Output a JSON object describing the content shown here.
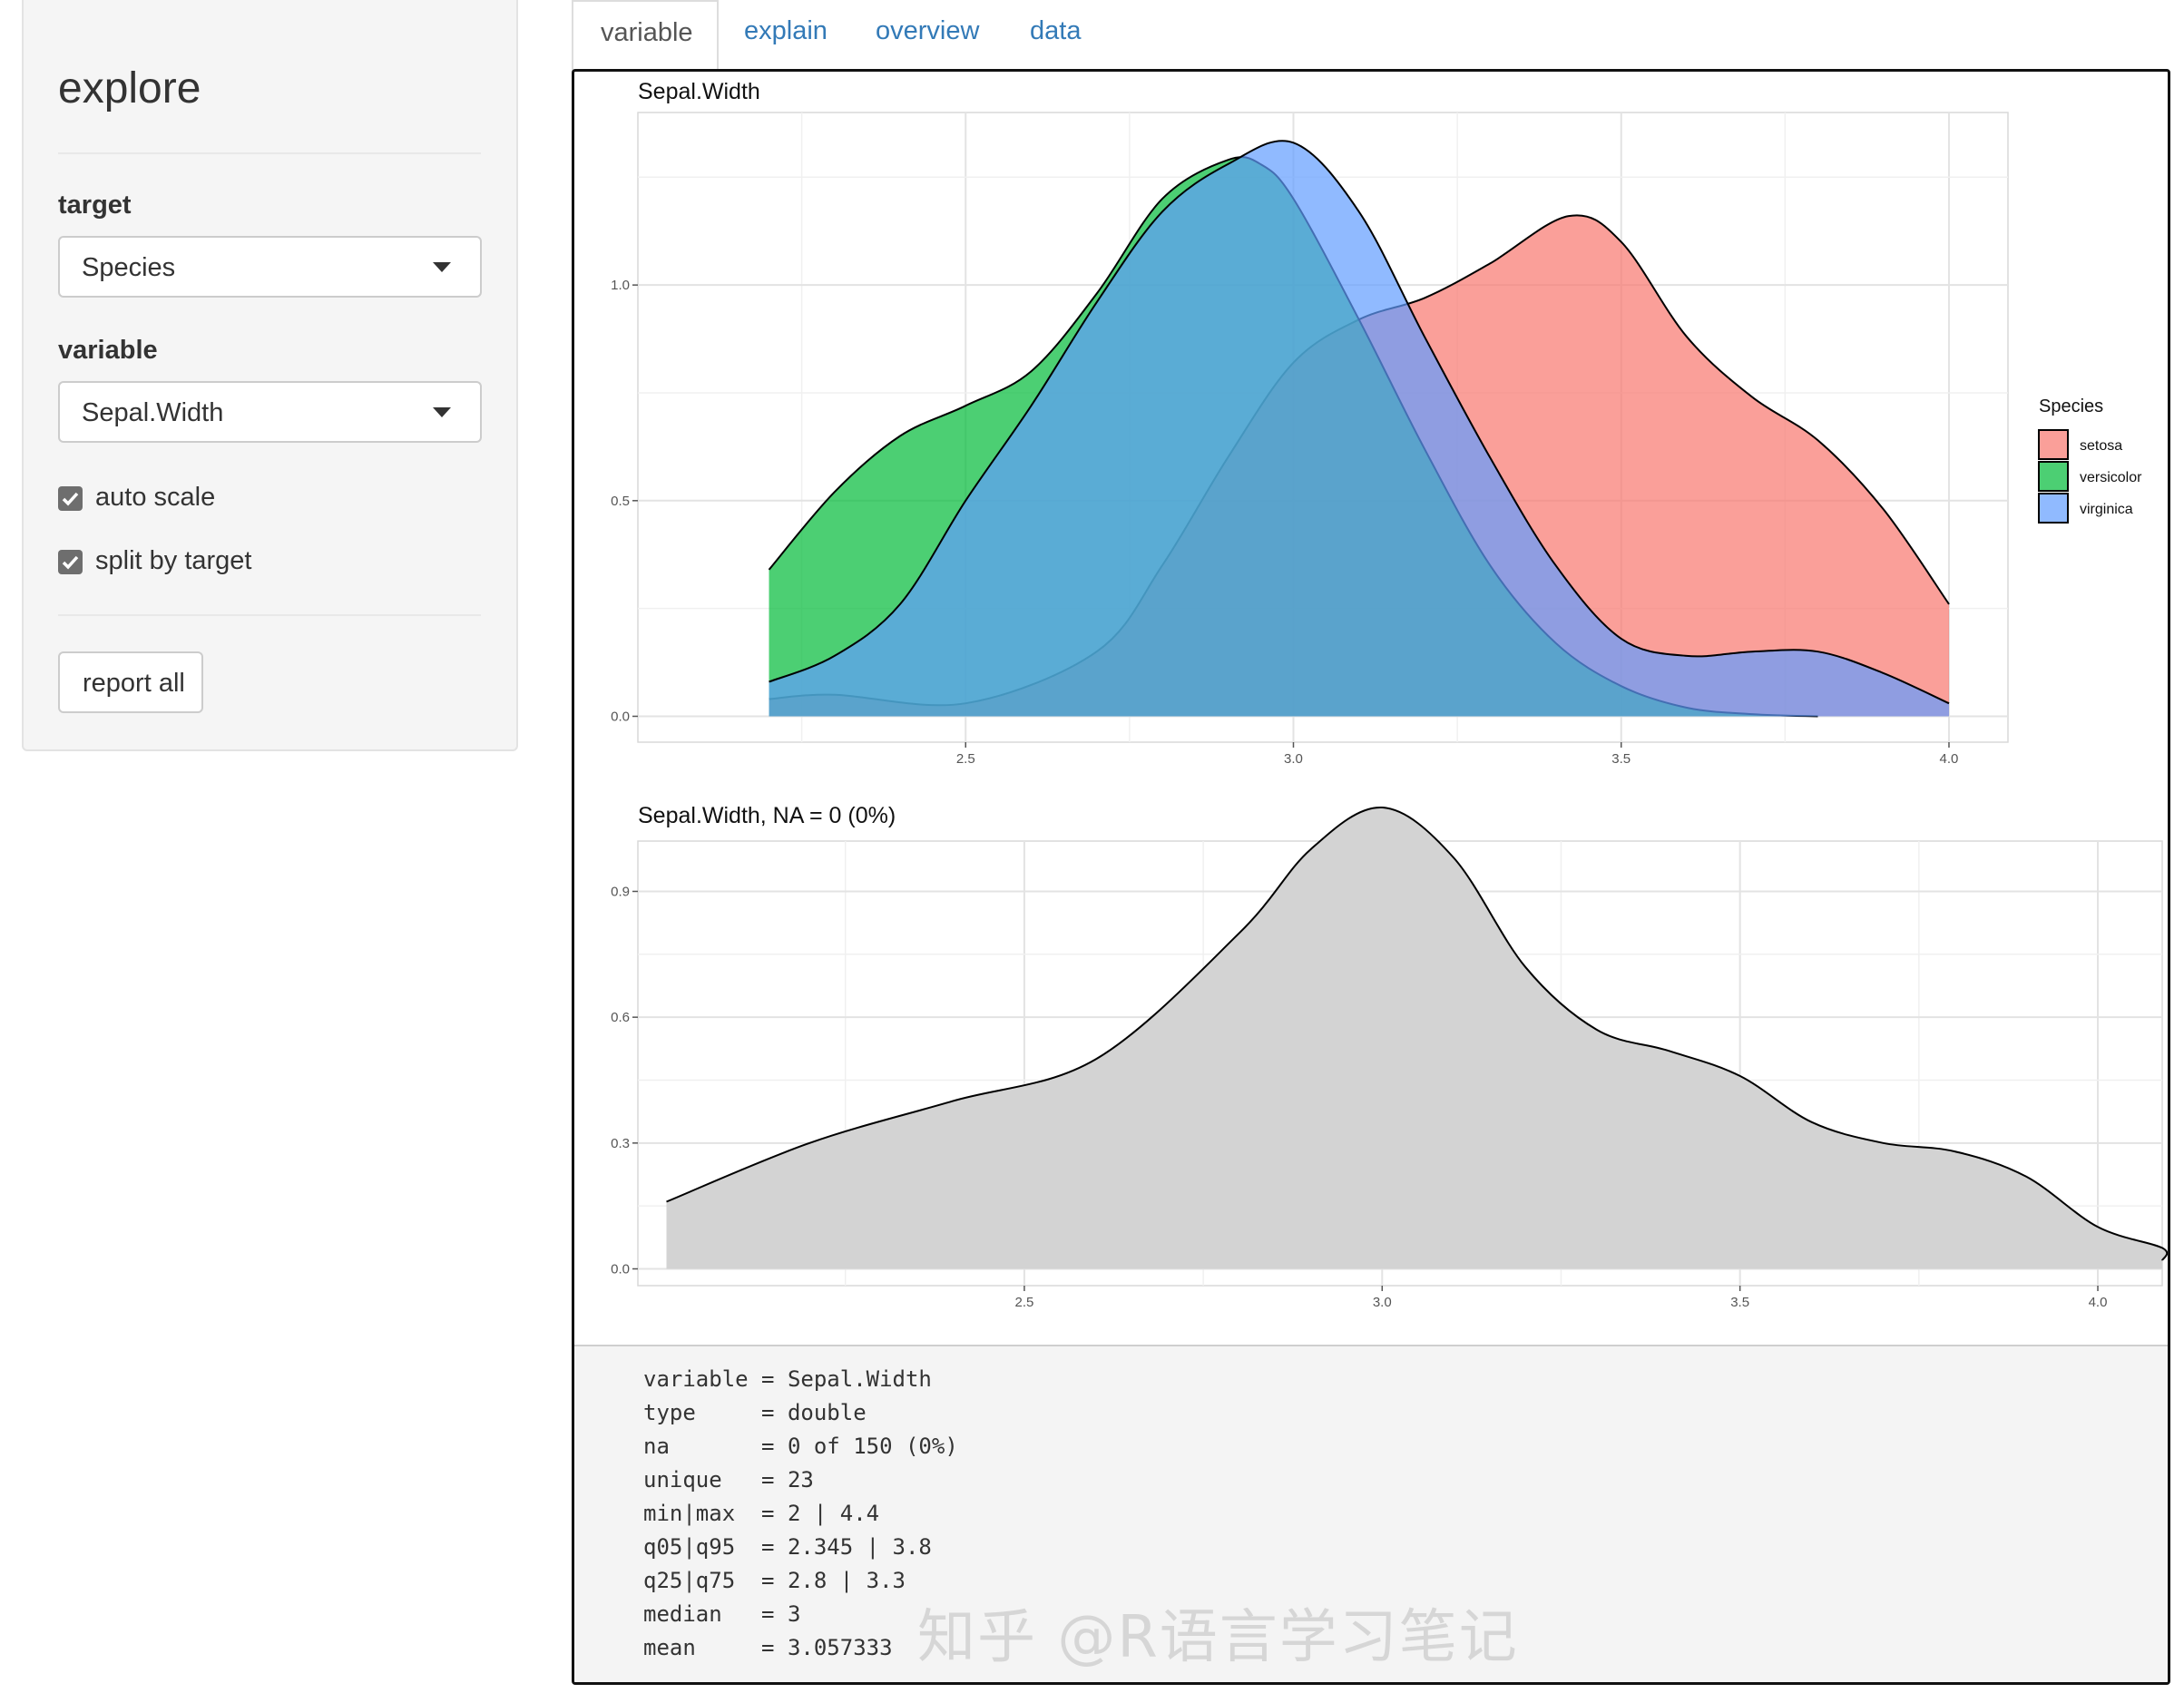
{
  "sidebar": {
    "title": "explore",
    "target_label": "target",
    "target_value": "Species",
    "variable_label": "variable",
    "variable_value": "Sepal.Width",
    "auto_scale_label": "auto scale",
    "auto_scale_checked": true,
    "split_label": "split by target",
    "split_checked": true,
    "report_button": "report all"
  },
  "tabs": [
    {
      "label": "variable",
      "active": true
    },
    {
      "label": "explain",
      "active": false
    },
    {
      "label": "overview",
      "active": false
    },
    {
      "label": "data",
      "active": false
    }
  ],
  "chart_data": [
    {
      "type": "area",
      "title": "Sepal.Width",
      "xlabel": "",
      "ylabel": "",
      "xlim": [
        2.0,
        4.09
      ],
      "ylim": [
        -0.06,
        1.4
      ],
      "xticks": [
        "2.5",
        "3.0",
        "3.5",
        "4.0"
      ],
      "xtick_values": [
        2.5,
        3.0,
        3.5,
        4.0
      ],
      "yticks": [
        "0.0",
        "0.5",
        "1.0"
      ],
      "ytick_values": [
        0.0,
        0.5,
        1.0
      ],
      "grid": true,
      "legend": {
        "title": "Species",
        "position": "right"
      },
      "series": [
        {
          "name": "setosa",
          "color": "#F8766D",
          "x": [
            2.2,
            2.3,
            2.5,
            2.7,
            2.8,
            2.9,
            3.0,
            3.1,
            3.2,
            3.3,
            3.42,
            3.5,
            3.6,
            3.7,
            3.8,
            3.9,
            4.0
          ],
          "y": [
            0.04,
            0.05,
            0.03,
            0.15,
            0.35,
            0.6,
            0.82,
            0.92,
            0.97,
            1.05,
            1.16,
            1.1,
            0.88,
            0.74,
            0.64,
            0.48,
            0.26
          ]
        },
        {
          "name": "versicolor",
          "color": "#00BA38",
          "x": [
            2.2,
            2.3,
            2.4,
            2.5,
            2.6,
            2.7,
            2.8,
            2.9,
            2.95,
            3.0,
            3.1,
            3.2,
            3.3,
            3.4,
            3.5,
            3.6,
            3.7,
            3.8
          ],
          "y": [
            0.34,
            0.52,
            0.65,
            0.72,
            0.8,
            0.98,
            1.2,
            1.29,
            1.28,
            1.2,
            0.92,
            0.62,
            0.35,
            0.17,
            0.07,
            0.02,
            0.005,
            0.0
          ]
        },
        {
          "name": "virginica",
          "color": "#619CFF",
          "x": [
            2.2,
            2.3,
            2.4,
            2.5,
            2.6,
            2.7,
            2.8,
            2.9,
            3.0,
            3.1,
            3.2,
            3.3,
            3.4,
            3.5,
            3.6,
            3.7,
            3.8,
            3.9,
            4.0
          ],
          "y": [
            0.08,
            0.14,
            0.26,
            0.5,
            0.72,
            0.96,
            1.17,
            1.28,
            1.33,
            1.17,
            0.88,
            0.6,
            0.35,
            0.18,
            0.14,
            0.15,
            0.15,
            0.1,
            0.03
          ]
        }
      ]
    },
    {
      "type": "area",
      "title": "Sepal.Width, NA = 0 (0%)",
      "xlabel": "",
      "ylabel": "",
      "xlim": [
        1.96,
        4.09
      ],
      "ylim": [
        -0.04,
        1.02
      ],
      "xticks": [
        "2.5",
        "3.0",
        "3.5",
        "4.0"
      ],
      "xtick_values": [
        2.5,
        3.0,
        3.5,
        4.0
      ],
      "yticks": [
        "0.0",
        "0.3",
        "0.6",
        "0.9"
      ],
      "ytick_values": [
        0.0,
        0.3,
        0.6,
        0.9
      ],
      "grid": true,
      "series": [
        {
          "name": "",
          "color": "#D3D3D3",
          "x": [
            2.0,
            2.2,
            2.4,
            2.6,
            2.8,
            2.9,
            3.0,
            3.1,
            3.2,
            3.3,
            3.4,
            3.5,
            3.6,
            3.7,
            3.8,
            3.9,
            4.0,
            4.2,
            4.4
          ],
          "y": [
            0.16,
            0.3,
            0.4,
            0.5,
            0.8,
            1.0,
            1.1,
            0.98,
            0.72,
            0.57,
            0.52,
            0.46,
            0.35,
            0.3,
            0.28,
            0.22,
            0.1,
            0.05,
            0.02
          ]
        }
      ]
    }
  ],
  "stats": [
    "variable = Sepal.Width",
    "type     = double",
    "na       = 0 of 150 (0%)",
    "unique   = 23",
    "min|max  = 2 | 4.4",
    "q05|q95  = 2.345 | 3.8",
    "q25|q75  = 2.8 | 3.3",
    "median   = 3",
    "mean     = 3.057333"
  ],
  "watermark": "知乎 @R语言学习笔记"
}
